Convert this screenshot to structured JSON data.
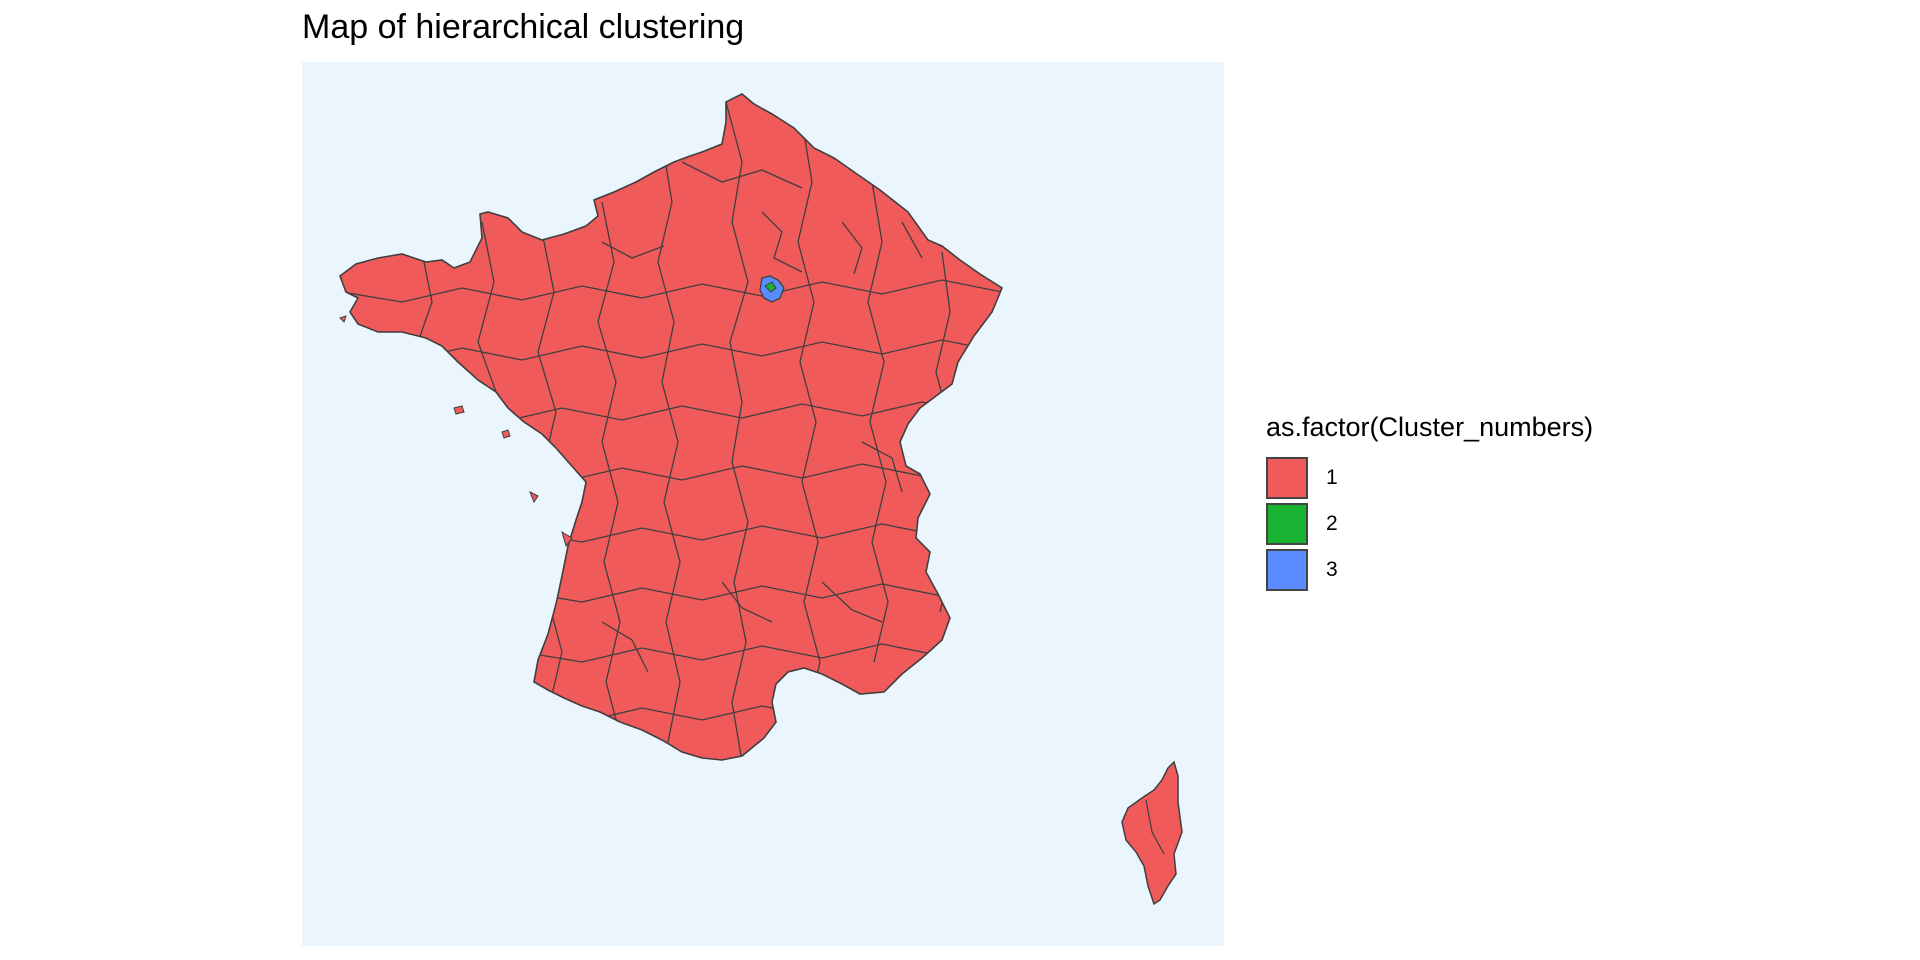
{
  "title": "Map of hierarchical clustering",
  "map": {
    "background_color": "#EBF5FD",
    "border_color": "#3f3f3f",
    "default_cluster": "1"
  },
  "legend": {
    "title": "as.factor(Cluster_numbers)",
    "items": [
      {
        "label": "1",
        "color": "#F15A5A"
      },
      {
        "label": "2",
        "color": "#1AB232"
      },
      {
        "label": "3",
        "color": "#5A8CFF"
      }
    ]
  }
}
